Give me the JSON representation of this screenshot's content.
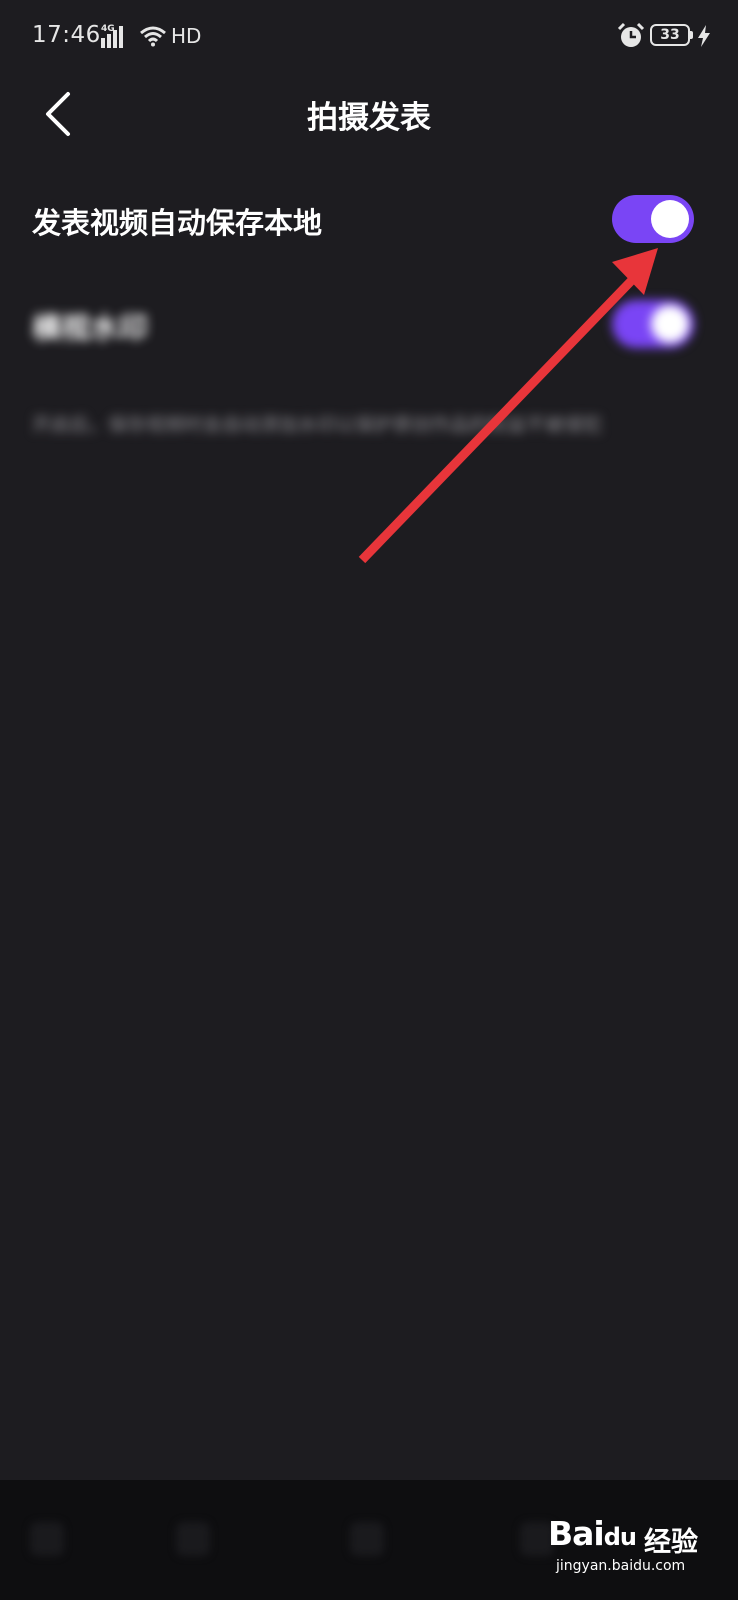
{
  "status_bar": {
    "time": "17:46",
    "network": "4G",
    "hd_label": "HD",
    "battery_level": "33",
    "icons": [
      "signal-icon",
      "wifi-icon",
      "alarm-icon",
      "battery-icon",
      "charging-bolt-icon"
    ]
  },
  "header": {
    "title": "拍摄发表",
    "back_icon": "chevron-left-icon"
  },
  "settings": [
    {
      "label": "发表视频自动保存本地",
      "enabled": true
    },
    {
      "label": "横视水印",
      "enabled": true,
      "blurred": true
    }
  ],
  "blurred_description": "开启后，保存视频时会自动添加水印以保护原创作品的权益不被侵犯",
  "annotation": {
    "type": "arrow",
    "color": "#e8353a"
  },
  "colors": {
    "background": "#1d1c20",
    "toggle_on": "#7a45f5",
    "text_primary": "#ffffff",
    "annotation": "#e8353a"
  },
  "watermark": {
    "logo": "Bai",
    "logo_paw_text": "du",
    "suffix": "经验",
    "url": "jingyan.baidu.com"
  }
}
